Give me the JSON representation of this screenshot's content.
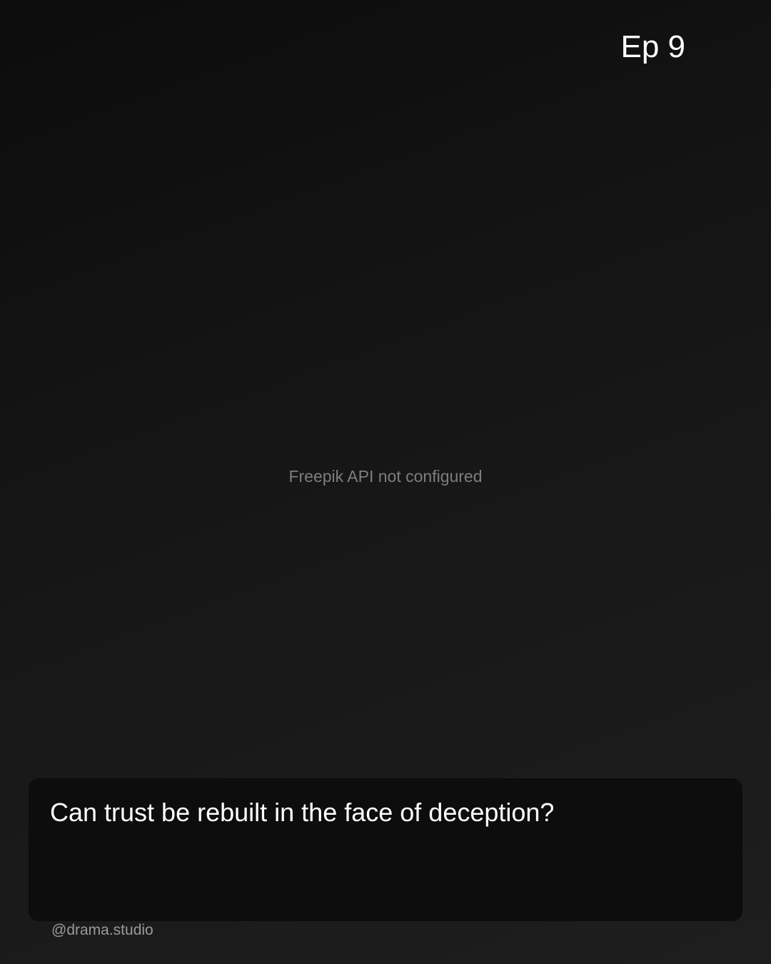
{
  "header": {
    "episode_label": "Ep 9"
  },
  "main": {
    "image_status": "Freepik API not configured"
  },
  "caption": {
    "text": "Can trust be rebuilt in the face of deception?"
  },
  "footer": {
    "handle": "@drama.studio"
  },
  "colors": {
    "background_dark": "#0c0c0c",
    "background_light": "#1e1e1e",
    "caption_box": "#0d0d0d",
    "text_primary": "#ffffff",
    "text_muted": "#7e7e7e",
    "handle_text": "#9a9a9a"
  }
}
